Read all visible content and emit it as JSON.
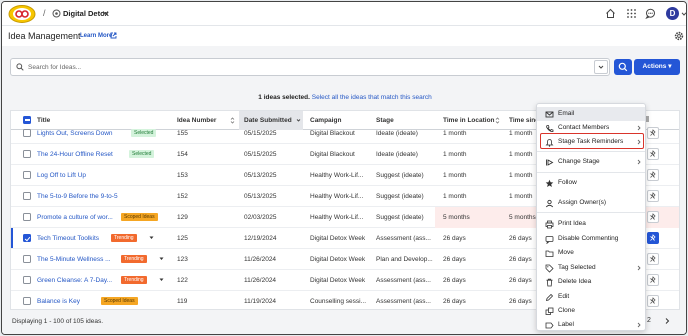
{
  "topbar": {
    "separator": "/",
    "workspace": "Digital Detox",
    "avatar_initial": "D"
  },
  "page": {
    "title": "Idea Management",
    "learn_more": "Learn More"
  },
  "search": {
    "placeholder": "Search for Ideas..."
  },
  "toolbar": {
    "actions_label": "Actions ▾"
  },
  "selection": {
    "count_text": "1 ideas selected.",
    "select_all_link": "Select all the ideas that match this search"
  },
  "table": {
    "columns": [
      "Title",
      "Idea Number",
      "Date Submitted",
      "Campaign",
      "Stage",
      "Time in Location",
      "Time since"
    ],
    "rows": [
      {
        "title": "Lights Out, Screens Down",
        "badge": "Selected",
        "number": "155",
        "date": "05/15/2025",
        "campaign": "Digital Blackout",
        "stage": "Ideate (ideate)",
        "time_loc": "1 month",
        "time_since": "1 month",
        "checked": false
      },
      {
        "title": "The 24-Hour Offline Reset",
        "badge": "Selected",
        "number": "154",
        "date": "05/15/2025",
        "campaign": "Digital Blackout",
        "stage": "Ideate (ideate)",
        "time_loc": "1 month",
        "time_since": "1 month",
        "checked": false
      },
      {
        "title": "Log Off to Lift Up",
        "badge": "",
        "number": "153",
        "date": "05/13/2025",
        "campaign": "Healthy Work-Lif...",
        "stage": "Suggest (ideate)",
        "time_loc": "1 month",
        "time_since": "1 month",
        "checked": false
      },
      {
        "title": "The 5-to-9 Before the 9-to-5",
        "badge": "",
        "number": "152",
        "date": "05/13/2025",
        "campaign": "Healthy Work-Lif...",
        "stage": "Suggest (ideate)",
        "time_loc": "1 month",
        "time_since": "1 month",
        "checked": false
      },
      {
        "title": "Promote a culture of wor...",
        "badge": "Scoped Ideas",
        "number": "129",
        "date": "02/03/2025",
        "campaign": "Healthy Work-Lif...",
        "stage": "Suggest (ideate)",
        "time_loc": "5 months",
        "time_since": "5 months",
        "checked": false
      },
      {
        "title": "Tech Timeout Toolkits",
        "badge": "Trending",
        "number": "125",
        "date": "12/19/2024",
        "campaign": "Digital Detox Week",
        "stage": "Assessment (ass...",
        "time_loc": "26 days",
        "time_since": "26 days",
        "checked": true
      },
      {
        "title": "The 5-Minute Wellness ...",
        "badge": "Trending",
        "number": "123",
        "date": "11/26/2024",
        "campaign": "Digital Detox Week",
        "stage": "Plan and Develop...",
        "time_loc": "26 days",
        "time_since": "26 days",
        "checked": false
      },
      {
        "title": "Green Cleanse: A 7-Day...",
        "badge": "Trending",
        "number": "122",
        "date": "11/26/2024",
        "campaign": "Digital Detox Week",
        "stage": "Assessment (ass...",
        "time_loc": "26 days",
        "time_since": "26 days",
        "checked": false
      },
      {
        "title": "Balance is Key",
        "badge": "Scoped Ideas",
        "number": "119",
        "date": "11/19/2024",
        "campaign": "Counselling sessi...",
        "stage": "Assessment (ass...",
        "time_loc": "26 days",
        "time_since": "26 days",
        "checked": false
      }
    ]
  },
  "footer": {
    "displaying": "Displaying 1 - 100 of 105 ideas.",
    "page": "2"
  },
  "menu": {
    "items": [
      {
        "label": "Email",
        "icon": "email-icon",
        "submenu": false
      },
      {
        "label": "Contact Members",
        "icon": "phone-icon",
        "submenu": true
      },
      {
        "label": "Stage Task Reminders",
        "icon": "bell-icon",
        "submenu": true
      },
      {
        "label": "Change Stage",
        "icon": "stage-icon",
        "submenu": true
      },
      {
        "label": "Follow",
        "icon": "star-icon",
        "submenu": false
      },
      {
        "label": "Assign Owner(s)",
        "icon": "person-icon",
        "submenu": false
      },
      {
        "label": "Print Idea",
        "icon": "print-icon",
        "submenu": false
      },
      {
        "label": "Disable Commenting",
        "icon": "comment-icon",
        "submenu": false
      },
      {
        "label": "Move",
        "icon": "folder-icon",
        "submenu": false
      },
      {
        "label": "Tag Selected",
        "icon": "tag-icon",
        "submenu": true
      },
      {
        "label": "Delete Idea",
        "icon": "trash-icon",
        "submenu": false
      },
      {
        "label": "Edit",
        "icon": "pencil-icon",
        "submenu": false
      },
      {
        "label": "Clone",
        "icon": "clone-icon",
        "submenu": false
      },
      {
        "label": "Label",
        "icon": "label-icon",
        "submenu": true
      }
    ]
  },
  "colors": {
    "primary": "#2456d6",
    "link": "#2457c5",
    "highlight_outline": "#d9342b",
    "trending": "#f26a2e",
    "scoped": "#f5a623"
  }
}
